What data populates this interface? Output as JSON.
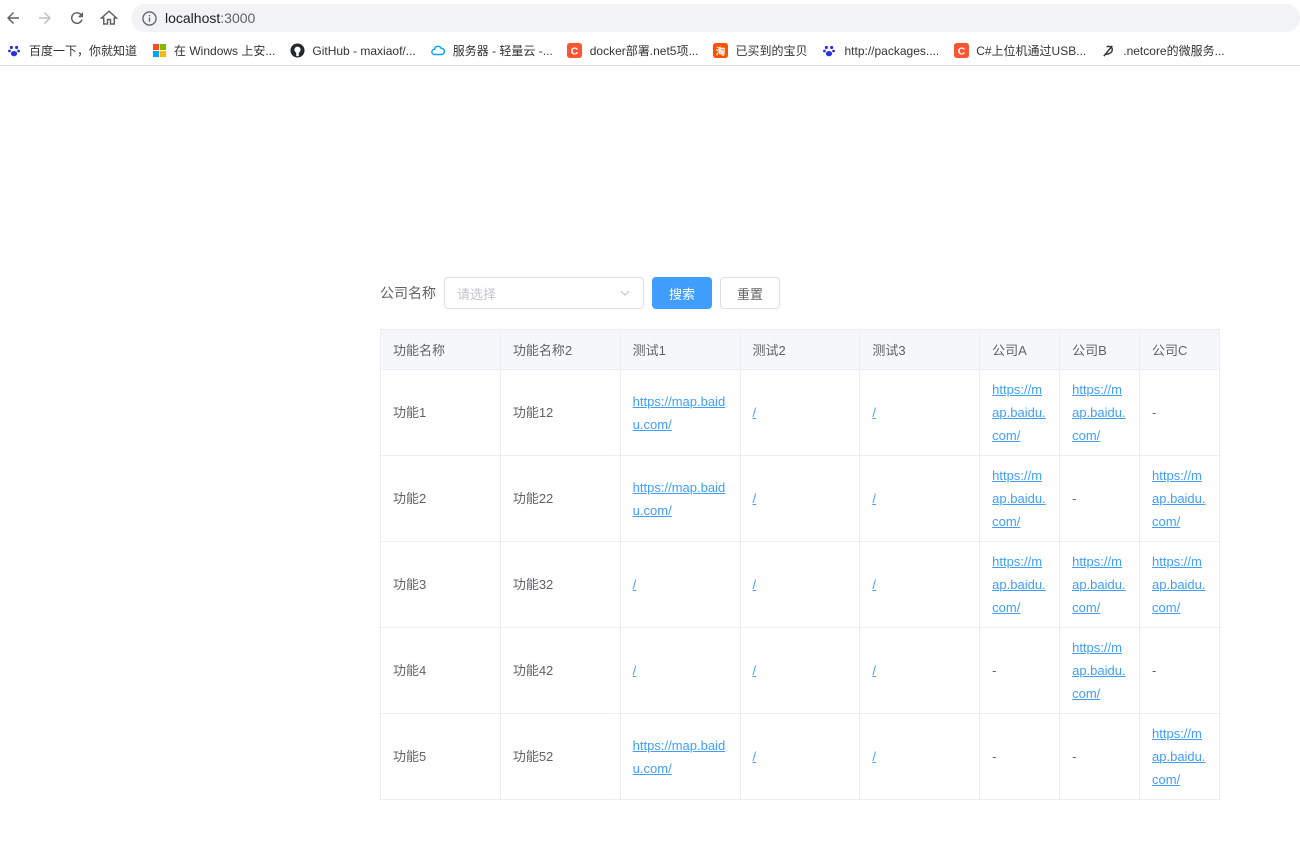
{
  "browser": {
    "url_host": "localhost",
    "url_port": ":3000",
    "bookmarks": [
      {
        "label": "百度一下，你就知道",
        "icon": "baidu-paw-icon",
        "color": "#2932e1"
      },
      {
        "label": "在 Windows 上安...",
        "icon": "windows-icon",
        "color": "#f25022"
      },
      {
        "label": "GitHub - maxiaof/...",
        "icon": "github-icon",
        "color": "#24292e"
      },
      {
        "label": "服务器 - 轻量云 -...",
        "icon": "cloud-icon",
        "color": "#00a4ff"
      },
      {
        "label": "docker部署.net5项...",
        "icon": "csdn-icon",
        "color": "#fc5531"
      },
      {
        "label": "已买到的宝贝",
        "icon": "taobao-icon",
        "color": "#ff5000"
      },
      {
        "label": "http://packages....",
        "icon": "baidu-paw-icon",
        "color": "#2932e1"
      },
      {
        "label": "C#上位机通过USB...",
        "icon": "csdn-icon",
        "color": "#fc5531"
      },
      {
        "label": ".netcore的微服务...",
        "icon": "feather-icon",
        "color": "#333333"
      }
    ]
  },
  "form": {
    "label": "公司名称",
    "select_placeholder": "请选择",
    "search_label": "搜索",
    "reset_label": "重置"
  },
  "table": {
    "headers": [
      "功能名称",
      "功能名称2",
      "测试1",
      "测试2",
      "测试3",
      "公司A",
      "公司B",
      "公司C"
    ],
    "rows": [
      [
        "功能1",
        "功能12",
        "https://map.baidu.com/",
        "/",
        "/",
        "https://map.baidu.com/",
        "https://map.baidu.com/",
        "-"
      ],
      [
        "功能2",
        "功能22",
        "https://map.baidu.com/",
        "/",
        "/",
        "https://map.baidu.com/",
        "-",
        "https://map.baidu.com/"
      ],
      [
        "功能3",
        "功能32",
        "/",
        "/",
        "/",
        "https://map.baidu.com/",
        "https://map.baidu.com/",
        "https://map.baidu.com/"
      ],
      [
        "功能4",
        "功能42",
        "/",
        "/",
        "/",
        "-",
        "https://map.baidu.com/",
        "-"
      ],
      [
        "功能5",
        "功能52",
        "https://map.baidu.com/",
        "/",
        "/",
        "-",
        "-",
        "https://map.baidu.com/"
      ]
    ]
  }
}
